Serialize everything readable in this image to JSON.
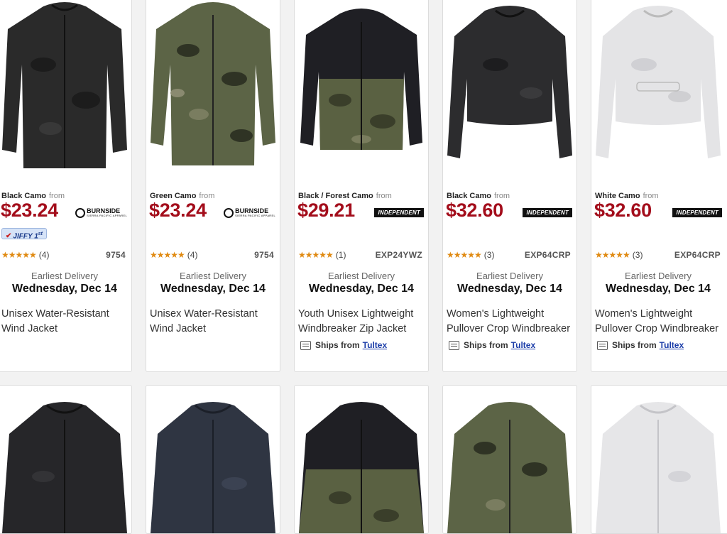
{
  "products_row1": [
    {
      "color": "Black Camo",
      "from": "from",
      "price": "$23.24",
      "brand": "BURNSIDE",
      "brand_sub": "SIERRA PACIFIC APPAREL",
      "badge": "JIFFY 1",
      "badge_sup": "st",
      "stars": "★★★★★",
      "reviews": "(4)",
      "sku": "9754",
      "delivery_label": "Earliest Delivery",
      "delivery_date": "Wednesday, Dec 14",
      "title": "Unisex Water-Resistant Wind Jacket",
      "ships_label": "",
      "ships_vendor": ""
    },
    {
      "color": "Green Camo",
      "from": "from",
      "price": "$23.24",
      "brand": "BURNSIDE",
      "brand_sub": "SIERRA PACIFIC APPAREL",
      "badge": "",
      "stars": "★★★★★",
      "reviews": "(4)",
      "sku": "9754",
      "delivery_label": "Earliest Delivery",
      "delivery_date": "Wednesday, Dec 14",
      "title": "Unisex Water-Resistant Wind Jacket",
      "ships_label": "",
      "ships_vendor": ""
    },
    {
      "color": "Black / Forest Camo",
      "from": "from",
      "price": "$29.21",
      "brand": "INDEPENDENT",
      "stars": "★★★★★",
      "reviews": "(1)",
      "sku": "EXP24YWZ",
      "delivery_label": "Earliest Delivery",
      "delivery_date": "Wednesday, Dec 14",
      "title": "Youth Unisex Lightweight Windbreaker Zip Jacket",
      "ships_label": "Ships from",
      "ships_vendor": "Tultex"
    },
    {
      "color": "Black Camo",
      "from": "from",
      "price": "$32.60",
      "brand": "INDEPENDENT",
      "stars": "★★★★★",
      "reviews": "(3)",
      "sku": "EXP64CRP",
      "delivery_label": "Earliest Delivery",
      "delivery_date": "Wednesday, Dec 14",
      "title": "Women's Lightweight Pullover Crop Windbreaker",
      "ships_label": "Ships from",
      "ships_vendor": "Tultex"
    },
    {
      "color": "White Camo",
      "from": "from",
      "price": "$32.60",
      "brand": "INDEPENDENT",
      "stars": "★★★★★",
      "reviews": "(3)",
      "sku": "EXP64CRP",
      "delivery_label": "Earliest Delivery",
      "delivery_date": "Wednesday, Dec 14",
      "title": "Women's Lightweight Pullover Crop Windbreaker",
      "ships_label": "Ships from",
      "ships_vendor": "Tultex"
    }
  ],
  "colors": {
    "price": "#a30d1b",
    "stars": "#e08a12",
    "link": "#1a3ca8",
    "black_camo": "#2b2b2b",
    "green_camo": "#5a6145",
    "navy_camo": "#2f3542",
    "white_camo": "#e6e6e6"
  },
  "icons": {
    "star": "star-icon",
    "truck": "truck-icon",
    "jiffy": "jiffy-check-icon"
  }
}
